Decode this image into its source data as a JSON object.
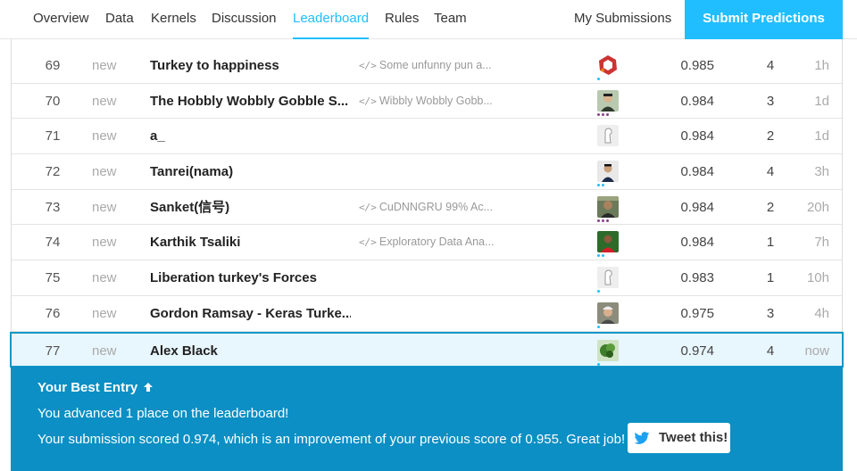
{
  "nav": {
    "tabs": [
      {
        "label": "Overview"
      },
      {
        "label": "Data"
      },
      {
        "label": "Kernels"
      },
      {
        "label": "Discussion"
      },
      {
        "label": "Leaderboard",
        "active": true
      },
      {
        "label": "Rules"
      },
      {
        "label": "Team"
      }
    ],
    "my_submissions": "My Submissions",
    "submit_predictions": "Submit Predictions"
  },
  "colors": {
    "accent": "#20beff",
    "panel": "#0b8fc4",
    "highlight_border": "#1597c8"
  },
  "rows": [
    {
      "rank": "69",
      "change": "new",
      "team": "Turkey to happiness",
      "kernel": "Some unfunny pun a...",
      "score": "0.985",
      "entries": "4",
      "last": "1h",
      "avatar": "red-ring-avatar"
    },
    {
      "rank": "70",
      "change": "new",
      "team": "The Hobbly Wobbly Gobble S...",
      "kernel": "Wibbly Wobbly Gobb...",
      "score": "0.984",
      "entries": "3",
      "last": "1d",
      "avatar": "person-photo-avatar"
    },
    {
      "rank": "71",
      "change": "new",
      "team": "a_",
      "kernel": "",
      "score": "0.984",
      "entries": "2",
      "last": "1d",
      "avatar": "default-avatar"
    },
    {
      "rank": "72",
      "change": "new",
      "team": "Tanrei(nama)",
      "kernel": "",
      "score": "0.984",
      "entries": "4",
      "last": "3h",
      "avatar": "person-photo-avatar"
    },
    {
      "rank": "73",
      "change": "new",
      "team": "Sanket(信号)",
      "kernel": "CuDNNGRU 99% Ac...",
      "score": "0.984",
      "entries": "2",
      "last": "20h",
      "avatar": "person-photo-avatar"
    },
    {
      "rank": "74",
      "change": "new",
      "team": "Karthik Tsaliki",
      "kernel": "Exploratory Data Ana...",
      "score": "0.984",
      "entries": "1",
      "last": "7h",
      "avatar": "person-photo-avatar"
    },
    {
      "rank": "75",
      "change": "new",
      "team": "Liberation turkey's Forces",
      "kernel": "",
      "score": "0.983",
      "entries": "1",
      "last": "10h",
      "avatar": "default-avatar"
    },
    {
      "rank": "76",
      "change": "new",
      "team": "Gordon Ramsay - Keras Turke...",
      "kernel": "",
      "score": "0.975",
      "entries": "3",
      "last": "4h",
      "avatar": "person-photo-avatar"
    },
    {
      "rank": "77",
      "change": "new",
      "team": "Alex Black",
      "kernel": "",
      "score": "0.974",
      "entries": "4",
      "last": "now",
      "avatar": "leaf-avatar",
      "highlight": true
    }
  ],
  "best_entry": {
    "title": "Your Best Entry",
    "line1": "You advanced 1 place on the leaderboard!",
    "line2": "Your submission scored 0.974, which is an improvement of your previous score of 0.955. Great job!",
    "tweet": "Tweet this!"
  }
}
